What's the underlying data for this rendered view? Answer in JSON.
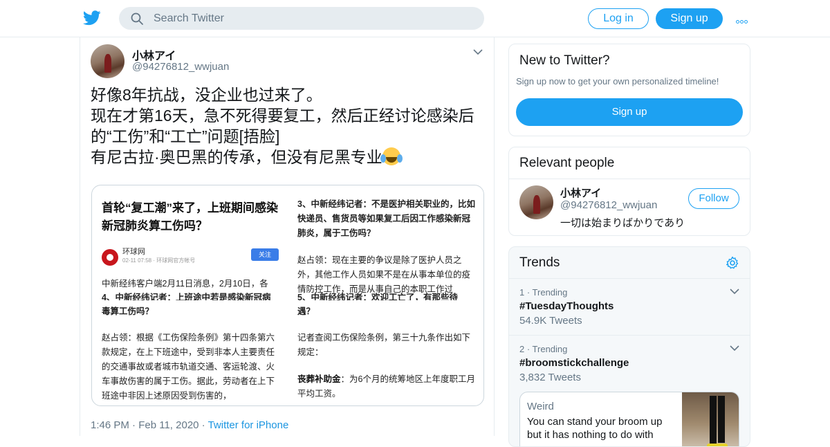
{
  "header": {
    "search_placeholder": "Search Twitter",
    "login_label": "Log in",
    "signup_label": "Sign up"
  },
  "tweet": {
    "author_name": "小林アイ",
    "author_handle": "@94276812_wwjuan",
    "text_lines": [
      "好像8年抗战，没企业也过来了。",
      "现在才第16天，急不死得要复工，然后正经讨论感染后",
      "的“工伤”和“工亡”问题[捂脸]",
      "有尼古拉·奥巴黑的传承，但没有尼黑专业"
    ],
    "time": "1:46 PM",
    "date": "Feb 11, 2020",
    "source": "Twitter for iPhone",
    "media": {
      "left": {
        "title": "首轮“复工潮”来了，上班期间感染新冠肺炎算工伤吗？",
        "source_name": "环球网",
        "source_meta": "02-11 07:58 · 环球网官方帐号",
        "follow_label": "关注",
        "intro": "中新经纬客户端2月11日消息，2月10日，各",
        "q_partial": "4、中新经纬记者：上班途中若是感染新冠病",
        "q_tail": "毒算工伤吗？",
        "answer": "赵占领：根据《工伤保险条例》第十四条第六款规定，在上下班途中，受到非本人主要责任的交通事故或者城市轨道交通、客运轮渡、火车事故伤害的属于工伤。据此，劳动者在上下班途中非因上述原因受到伤害的，"
      },
      "right": {
        "question": "3、中新经纬记者：不是医护相关职业的，比如快递员、售货员等如果复工后因工作感染新冠肺炎，属于工伤吗？",
        "answer": "赵占领：现在主要的争议是除了医护人员之外，其他工作人员如果不是在从事本单位的疫情防控工作，而是从事自己的本职工作过",
        "q_partial": "5、中新经纬记者：欢迎工亡了，有那些待",
        "q_tail": "遇？",
        "note": "记者查阅工伤保险条例，第三十九条作出如下规定：",
        "funeral_label": "丧葬补助金",
        "funeral_text": "：为6个月的统筹地区上年度职工月平均工资。"
      }
    }
  },
  "new_to_twitter": {
    "title": "New to Twitter?",
    "subtitle": "Sign up now to get your own personalized timeline!",
    "button": "Sign up"
  },
  "relevant_people": {
    "title": "Relevant people",
    "name": "小林アイ",
    "handle": "@94276812_wwjuan",
    "bio": "一切は始まりばかりであり",
    "follow_label": "Follow"
  },
  "trends": {
    "title": "Trends",
    "items": [
      {
        "meta": "1 · Trending",
        "tag": "#TuesdayThoughts",
        "count": "54.9K Tweets"
      },
      {
        "meta": "2 · Trending",
        "tag": "#broomstickchallenge",
        "count": "3,832 Tweets"
      }
    ],
    "moment": {
      "category": "Weird",
      "text": "You can stand your broom up but it has nothing to do with"
    }
  },
  "colors": {
    "brand": "#1da1f2",
    "link": "#1b95e0",
    "muted": "#657786",
    "border": "#e6ecf0"
  }
}
